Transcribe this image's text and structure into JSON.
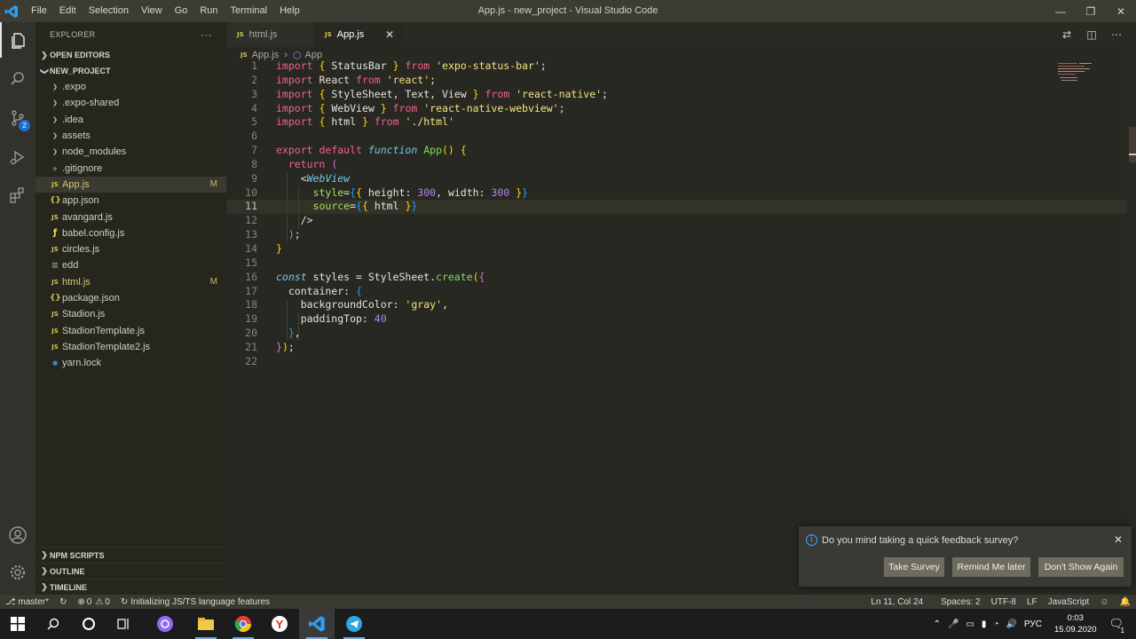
{
  "window": {
    "title": "App.js - new_project - Visual Studio Code"
  },
  "menu": [
    "File",
    "Edit",
    "Selection",
    "View",
    "Go",
    "Run",
    "Terminal",
    "Help"
  ],
  "activity": {
    "scm_badge": "2"
  },
  "sidebar": {
    "header": "EXPLORER",
    "more": "···",
    "open_editors": "OPEN EDITORS",
    "project": "NEW_PROJECT",
    "items": [
      {
        "icon": "chevron",
        "label": ".expo",
        "mod": ""
      },
      {
        "icon": "chevron",
        "label": ".expo-shared",
        "mod": ""
      },
      {
        "icon": "chevron",
        "label": ".idea",
        "mod": ""
      },
      {
        "icon": "chevron",
        "label": "assets",
        "mod": ""
      },
      {
        "icon": "chevron",
        "label": "node_modules",
        "mod": ""
      },
      {
        "icon": "git",
        "label": ".gitignore",
        "mod": ""
      },
      {
        "icon": "JS",
        "label": "App.js",
        "mod": "M"
      },
      {
        "icon": "{}",
        "label": "app.json",
        "mod": ""
      },
      {
        "icon": "JS",
        "label": "avangard.js",
        "mod": ""
      },
      {
        "icon": "babel",
        "label": "babel.config.js",
        "mod": ""
      },
      {
        "icon": "JS",
        "label": "circles.js",
        "mod": ""
      },
      {
        "icon": "≡",
        "label": "edd",
        "mod": ""
      },
      {
        "icon": "JS",
        "label": "html.js",
        "mod": "M"
      },
      {
        "icon": "{}",
        "label": "package.json",
        "mod": ""
      },
      {
        "icon": "JS",
        "label": "Stadion.js",
        "mod": ""
      },
      {
        "icon": "JS",
        "label": "StadionTemplate.js",
        "mod": ""
      },
      {
        "icon": "JS",
        "label": "StadionTemplate2.js",
        "mod": ""
      },
      {
        "icon": "yarn",
        "label": "yarn.lock",
        "mod": ""
      }
    ],
    "bottom": [
      "NPM SCRIPTS",
      "OUTLINE",
      "TIMELINE"
    ]
  },
  "tabs": [
    {
      "badge": "JS",
      "label": "html.js",
      "active": false
    },
    {
      "badge": "JS",
      "label": "App.js",
      "active": true,
      "close": "✕"
    }
  ],
  "breadcrumb": {
    "badge": "JS",
    "file": "App.js",
    "sep": "›",
    "symbol": "App"
  },
  "editor": {
    "current_line": 11,
    "lines": [
      "1",
      "2",
      "3",
      "4",
      "5",
      "6",
      "7",
      "8",
      "9",
      "10",
      "11",
      "12",
      "13",
      "14",
      "15",
      "16",
      "17",
      "18",
      "19",
      "20",
      "21",
      "22"
    ]
  },
  "notification": {
    "message": "Do you mind taking a quick feedback survey?",
    "close": "✕",
    "buttons": [
      "Take Survey",
      "Remind Me later",
      "Don't Show Again"
    ]
  },
  "statusbar": {
    "branch": "master*",
    "errors": "0",
    "warnings": "0",
    "task": "Initializing JS/TS language features",
    "position": "Ln 11, Col 24",
    "spaces": "Spaces: 2",
    "encoding": "UTF-8",
    "eol": "LF",
    "language": "JavaScript"
  },
  "taskbar": {
    "lang": "РУС",
    "time": "0:03",
    "date": "15.09.2020",
    "notif_count": "1"
  }
}
